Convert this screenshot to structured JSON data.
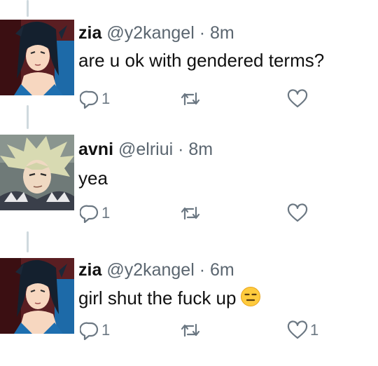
{
  "tweets": [
    {
      "name": "zia",
      "handle": "@y2kangel",
      "time": "8m",
      "text": "are u ok with gendered terms?",
      "reply_count": "1",
      "retweet_count": "",
      "like_count": "",
      "avatar": "dark-haired-anime-girl-avatar"
    },
    {
      "name": "avni",
      "handle": "@elriui",
      "time": "8m",
      "text": "yea",
      "reply_count": "1",
      "retweet_count": "",
      "like_count": "",
      "avatar": "blond-anime-boy-avatar"
    },
    {
      "name": "zia",
      "handle": "@y2kangel",
      "time": "6m",
      "text": "girl shut the fuck up",
      "emoji": "expressionless-face-emoji",
      "reply_count": "1",
      "retweet_count": "",
      "like_count": "1",
      "avatar": "dark-haired-anime-girl-avatar"
    }
  ],
  "separator": "·",
  "icons": {
    "reply": "reply-icon",
    "retweet": "retweet-icon",
    "like": "heart-icon"
  },
  "colors": {
    "text": "#111111",
    "meta": "#5b6670",
    "icon": "#6b7782",
    "thread_line": "#cfd9de"
  }
}
